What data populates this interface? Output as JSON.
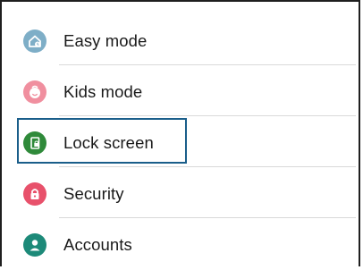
{
  "settings": {
    "items": [
      {
        "label": "Easy mode",
        "icon": "easy-mode-icon",
        "color": "#7eaec7"
      },
      {
        "label": "Kids mode",
        "icon": "kids-mode-icon",
        "color": "#f08f9f"
      },
      {
        "label": "Lock screen",
        "icon": "lock-screen-icon",
        "color": "#2f8a3a"
      },
      {
        "label": "Security",
        "icon": "lock-icon",
        "color": "#e8516b"
      },
      {
        "label": "Accounts",
        "icon": "account-icon",
        "color": "#1d8a79"
      }
    ],
    "focused_item": "Lock screen"
  }
}
